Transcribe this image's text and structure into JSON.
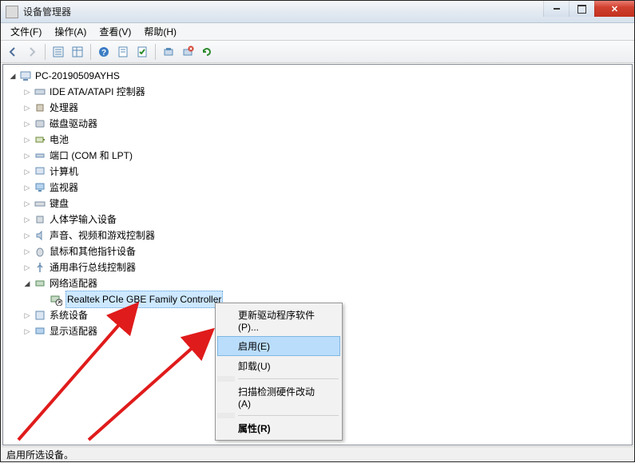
{
  "window": {
    "title": "设备管理器"
  },
  "menu": {
    "file": "文件(F)",
    "action": "操作(A)",
    "view": "查看(V)",
    "help": "帮助(H)"
  },
  "tree": {
    "root": "PC-20190509AYHS",
    "items": [
      {
        "label": "IDE ATA/ATAPI 控制器"
      },
      {
        "label": "处理器"
      },
      {
        "label": "磁盘驱动器"
      },
      {
        "label": "电池"
      },
      {
        "label": "端口 (COM 和 LPT)"
      },
      {
        "label": "计算机"
      },
      {
        "label": "监视器"
      },
      {
        "label": "键盘"
      },
      {
        "label": "人体学输入设备"
      },
      {
        "label": "声音、视频和游戏控制器"
      },
      {
        "label": "鼠标和其他指针设备"
      },
      {
        "label": "通用串行总线控制器"
      },
      {
        "label": "网络适配器"
      },
      {
        "label": "系统设备"
      },
      {
        "label": "显示适配器"
      }
    ],
    "network_child": "Realtek PCIe GBE Family Controller"
  },
  "context_menu": {
    "update_driver": "更新驱动程序软件(P)...",
    "enable": "启用(E)",
    "uninstall": "卸载(U)",
    "scan_hardware": "扫描检测硬件改动(A)",
    "properties": "属性(R)"
  },
  "status": {
    "text": "启用所选设备。"
  }
}
